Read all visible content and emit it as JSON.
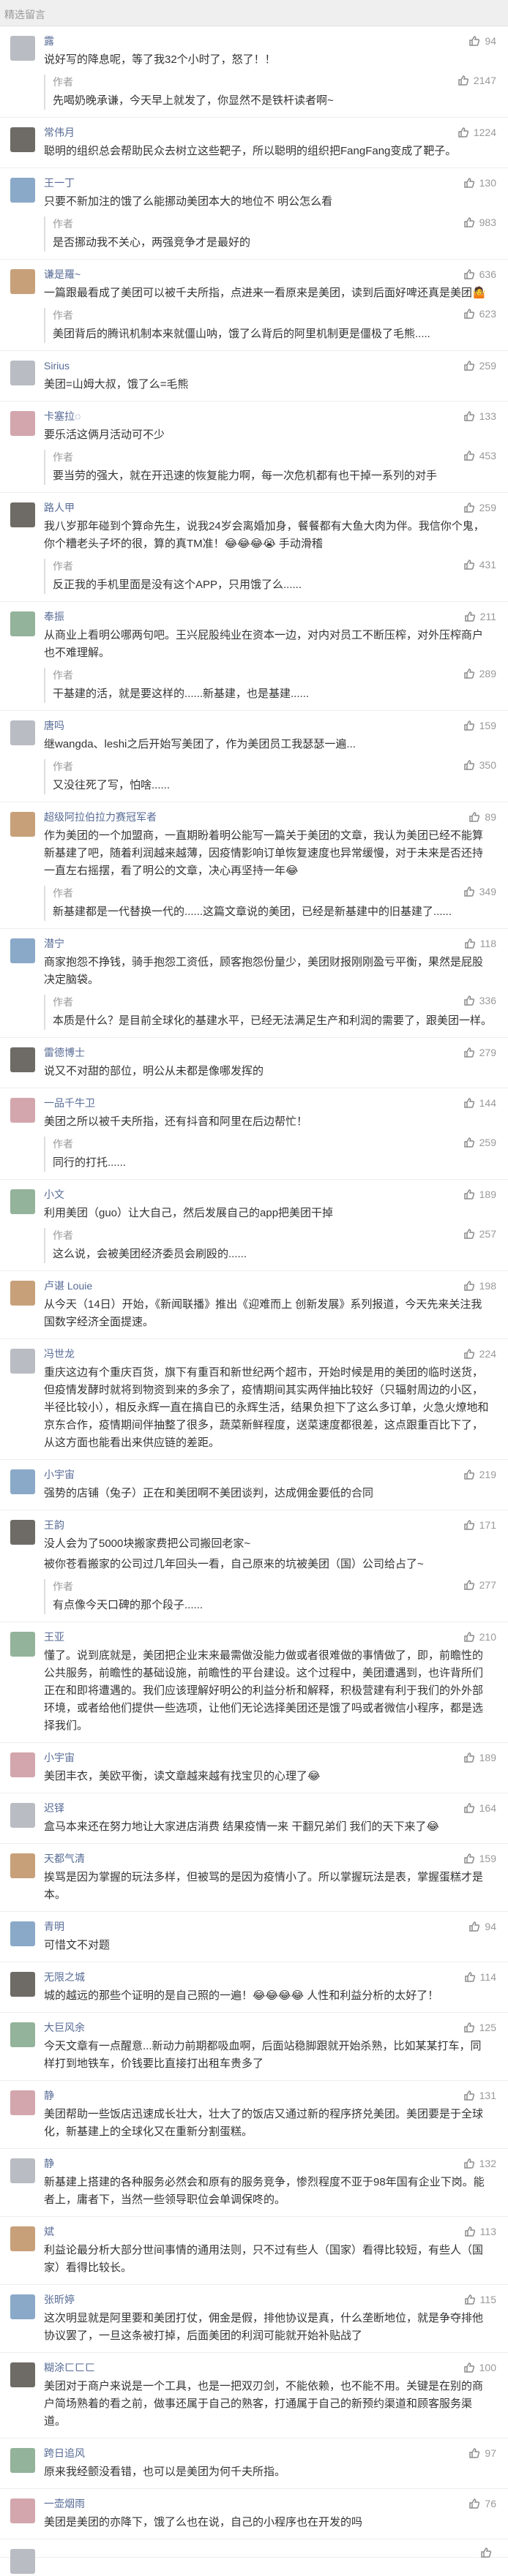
{
  "header": {
    "title": "精选留言"
  },
  "comments": [
    {
      "author": "露",
      "likes": "94",
      "text": "说好写的降息呢，等了我32个小时了，怒了！！",
      "reply_tag": "作者",
      "reply_likes": "2147",
      "reply": "先喝奶晚承谦，今天早上就发了，你显然不是铁杆读者啊~"
    },
    {
      "author": "常伟月",
      "likes": "1224",
      "text": "聪明的组织总会帮助民众去树立这些靶子，所以聪明的组织把FangFang变成了靶子。"
    },
    {
      "author": "王一丁",
      "likes": "130",
      "text": "只要不新加注的饿了么能挪动美团本大的地位不 明公怎么看",
      "reply_tag": "作者",
      "reply_likes": "983",
      "reply": "是否挪动我不关心，两强竞争才是最好的"
    },
    {
      "author": "谦是羅~",
      "likes": "636",
      "text": "一篇跟最看成了美团可以被千夫所指，点进来一看原来是美团，读到后面好啤还真是美团🤷",
      "reply_tag": "作者",
      "reply_likes": "623",
      "reply": "美团背后的腾讯机制本来就僵山呐，饿了么背后的阿里机制更是僵极了毛熊....."
    },
    {
      "author": "Sirius",
      "likes": "259",
      "text": "美团=山姆大叔，饿了么=毛熊"
    },
    {
      "author": "卡塞拉◌",
      "likes": "133",
      "text": "要乐活这俩月活动可不少",
      "reply_tag": "作者",
      "reply_likes": "453",
      "reply": "要当劳的强大，就在开迅速的恢复能力啊，每一次危机都有也干掉一系列的对手"
    },
    {
      "author": "路人甲",
      "likes": "259",
      "text": "我八岁那年碰到个算命先生，说我24岁会离婚加身，餐餐都有大鱼大肉为伴。我信你个鬼，你个糟老头子坏的很，算的真TM准！😂😂😂😭 手动滑稽",
      "reply_tag": "作者",
      "reply_likes": "431",
      "reply": "反正我的手机里面是没有这个APP，只用饿了么......"
    },
    {
      "author": "奉振",
      "likes": "211",
      "text": "从商业上看明公哪两句吧。王兴屁股纯业在资本一边，对内对员工不断压榨，对外压榨商户也不难理解。",
      "reply_tag": "作者",
      "reply_likes": "289",
      "reply": "干基建的活，就是要这样的......新基建，也是基建......"
    },
    {
      "author": "唐吗",
      "likes": "159",
      "text": "继wangda、leshi之后开始写美团了，作为美团员工我瑟瑟一遍...",
      "reply_tag": "作者",
      "reply_likes": "350",
      "reply": "又没往死了写，怕啥......"
    },
    {
      "author": "超级阿拉伯拉力赛冠军者",
      "likes": "89",
      "text": "作为美团的一个加盟商，一直期盼着明公能写一篇关于美团的文章，我认为美团已经不能算新基建了吧，随着利润越来越薄，因疫情影响订单恢复速度也异常缓慢，对于未来是否还持一直左右摇摆，看了明公的文章，决心再坚持一年😂",
      "reply_tag": "作者",
      "reply_likes": "349",
      "reply": "新基建都是一代替换一代的......这篇文章说的美团，已经是新基建中的旧基建了......"
    },
    {
      "author": "潜宁",
      "likes": "118",
      "text": "商家抱怨不挣钱，骑手抱怨工资低，顾客抱怨份量少，美团财报刚刚盈亏平衡，果然是屁股决定脑袋。",
      "reply_tag": "作者",
      "reply_likes": "336",
      "reply": "本质是什么？是目前全球化的基建水平，已经无法满足生产和利润的需要了，跟美团一样。"
    },
    {
      "author": "雷德博士",
      "likes": "279",
      "text": "说又不对甜的部位，明公从未都是像哪发挥的"
    },
    {
      "author": "一品千牛卫",
      "likes": "144",
      "text": "美团之所以被千夫所指，还有抖音和阿里在后边帮忙！",
      "reply_tag": "作者",
      "reply_likes": "259",
      "reply": "同行的打托......"
    },
    {
      "author": "小文",
      "likes": "189",
      "text": "利用美团（guo）让大自己，然后发展自己的app把美团干掉",
      "reply_tag": "作者",
      "reply_likes": "257",
      "reply": "这么说，会被美团经济委员会刷殴的......"
    },
    {
      "author": "卢谌 Louie",
      "likes": "198",
      "text": "从今天（14日）开始，《新闻联播》推出《迎难而上 创新发展》系列报道，今天先来关注我国数字经济全面提速。"
    },
    {
      "author": "冯世龙",
      "likes": "224",
      "text": "重庆这边有个重庆百货，旗下有重百和新世纪两个超市，开始时候是用的美团的临时送货，但疫情发酵时就将到物资到来的多余了，疫情期间其实两伴抽比较好（只辐射周边的小区，半径比较小），相反永辉一直在搞自已的永辉生活，结果负担下了这么多订单，火急火燎地和京东合作，疫情期间伴抽整了很多，蔬菜新鲜程度，送菜速度都很差，这点跟重百比下了，从这方面也能看出来供应链的差距。"
    },
    {
      "author": "小宇宙",
      "likes": "219",
      "text": "强势的店铺（兔子）正在和美团啊不美团谈判，达成佣金要低的合同"
    },
    {
      "author": "王韵",
      "likes": "171",
      "text": "没人会为了5000块搬家费把公司搬回老家~",
      "text2": "被你苍看搬家的公司过几年回头一看，自己原来的坑被美团（国）公司给占了~",
      "reply_tag": "作者",
      "reply_likes": "277",
      "reply": "有点像今天口碑的那个段子......"
    },
    {
      "author": "王亚",
      "likes": "210",
      "text": "懂了。说到底就是，美团把企业末来最需做没能力做或者很难做的事情做了，即，前瞻性的公共服务，前瞻性的基础设施，前瞻性的平台建设。这个过程中，美团遭遇到，也许背所们正在和即将遭遇的。我们应该理解好明公的利益分析和解释，积极营建有利于我们的外外部环境，或者给他们提供一些选项，让他们无论选择美团还是饿了吗或者微信小程序，都是选择我们。"
    },
    {
      "author": "小宇宙",
      "likes": "189",
      "text": "美团丰衣，美欧平衡，读文章越来越有找宝贝的心理了😂"
    },
    {
      "author": "迟铎",
      "likes": "164",
      "text": "盒马本来还在努力地让大家进店消费 结果疫情一来 干翻兄弟们 我们的天下来了😂"
    },
    {
      "author": "天都气清",
      "likes": "159",
      "text": "挨骂是因为掌握的玩法多样，但被骂的是因为疫情小了。所以掌握玩法是表，掌握蛋糕才是本。"
    },
    {
      "author": "青明",
      "likes": "94",
      "text": "可惜文不对题"
    },
    {
      "author": "无限之城",
      "likes": "114",
      "text": "城的越远的那些个证明的是自己照的一遍！😂😂😂😂 人性和利益分析的太好了！"
    },
    {
      "author": "大巨风余",
      "likes": "125",
      "text": "今天文章有一点醒意...新动力前期都吸血啊，后面站稳脚跟就开始杀熟，比如某某打车，同样打到地铁车，价钱要比直接打出租车贵多了"
    },
    {
      "author": "静",
      "likes": "131",
      "text": "美团帮助一些饭店迅速成长壮大，壮大了的饭店又通过新的程序挤兑美团。美团要是于全球化，新基建上的全球化又在重新分割蛋糕。"
    },
    {
      "author": "静",
      "likes": "132",
      "text": "新基建上搭建的各种服务必然会和原有的服务竞争，惨烈程度不亚于98年国有企业下岗。能者上，庸者下，当然一些领导职位会单调保咚的。"
    },
    {
      "author": "斌",
      "likes": "113",
      "text": "利益论最分析大部分世间事情的通用法则，只不过有些人（国家）看得比较短，有些人（国家）看得比较长。"
    },
    {
      "author": "张昕婷",
      "likes": "115",
      "text": "这次明显就是阿里要和美团打仗，佣金是假，排他协议是真，什么垄断地位，就是争夺排他协议罢了，一旦这条被打掉，后面美团的利润可能就开始补贴战了"
    },
    {
      "author": "糊涂ㄈㄈㄈ",
      "likes": "100",
      "text": "美团对于商户来说是一个工具，也是一把双刃剑，不能依赖，也不能不用。关键是在别的商户简场熟着的看之前，做事还属于自己的熟客，打通属于自己的新预约渠道和顾客服务渠道。"
    },
    {
      "author": "跨日追风",
      "likes": "97",
      "text": "原来我经颤没看错，也可以是美团为何千夫所指。"
    },
    {
      "author": "一壶烟雨",
      "likes": "76",
      "text": "美团是美团的亦降下，饿了么也在说，自己的小程序也在开发的吗"
    }
  ]
}
